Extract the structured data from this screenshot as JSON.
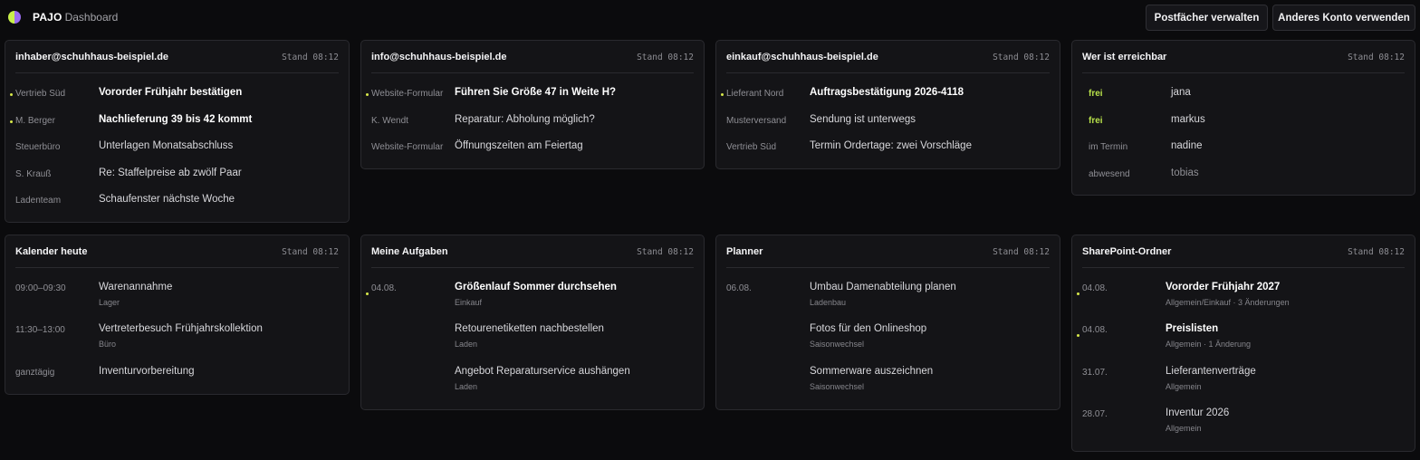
{
  "header": {
    "brand": "PAJO",
    "title": "Dashboard",
    "buttons": [
      "Postfächer verwalten",
      "Anderes Konto verwenden"
    ]
  },
  "colors": {
    "accent": "#d7e84a",
    "free": "#b7e04a",
    "logo_left": "#c9f04a",
    "logo_right": "#9a6df0"
  },
  "mailboxes": [
    {
      "title": "inhaber@schuhhaus-beispiel.de",
      "stamp": "Stand 08:12",
      "items": [
        {
          "sender": "Vertrieb Süd",
          "subject": "Vororder Frühjahr bestätigen",
          "unread": true
        },
        {
          "sender": "M. Berger",
          "subject": "Nachlieferung 39 bis 42 kommt",
          "unread": true
        },
        {
          "sender": "Steuerbüro",
          "subject": "Unterlagen Monatsabschluss",
          "unread": false
        },
        {
          "sender": "S. Krauß",
          "subject": "Re: Staffelpreise ab zwölf Paar",
          "unread": false
        },
        {
          "sender": "Ladenteam",
          "subject": "Schaufenster nächste Woche",
          "unread": false
        }
      ]
    },
    {
      "title": "info@schuhhaus-beispiel.de",
      "stamp": "Stand 08:12",
      "items": [
        {
          "sender": "Website-Formular",
          "subject": "Führen Sie Größe 47 in Weite H?",
          "unread": true
        },
        {
          "sender": "K. Wendt",
          "subject": "Reparatur: Abholung möglich?",
          "unread": false
        },
        {
          "sender": "Website-Formular",
          "subject": "Öffnungszeiten am Feiertag",
          "unread": false
        }
      ]
    },
    {
      "title": "einkauf@schuhhaus-beispiel.de",
      "stamp": "Stand 08:12",
      "items": [
        {
          "sender": "Lieferant Nord",
          "subject": "Auftragsbestätigung 2026-4118",
          "unread": true
        },
        {
          "sender": "Musterversand",
          "subject": "Sendung ist unterwegs",
          "unread": false
        },
        {
          "sender": "Vertrieb Süd",
          "subject": "Termin Ordertage: zwei Vorschläge",
          "unread": false
        }
      ]
    }
  ],
  "availability": {
    "title": "Wer ist erreichbar",
    "stamp": "Stand 08:12",
    "people": [
      {
        "status": "frei",
        "name": "jana"
      },
      {
        "status": "frei",
        "name": "markus"
      },
      {
        "status": "im Termin",
        "name": "nadine"
      },
      {
        "status": "abwesend",
        "name": "tobias"
      }
    ]
  },
  "calendar": {
    "title": "Kalender heute",
    "stamp": "Stand 08:12",
    "events": [
      {
        "time": "09:00–09:30",
        "title": "Warenannahme",
        "location": "Lager"
      },
      {
        "time": "11:30–13:00",
        "title": "Vertreterbesuch Frühjahrskollektion",
        "location": "Büro"
      },
      {
        "time": "ganztägig",
        "title": "Inventurvorbereitung",
        "location": ""
      }
    ]
  },
  "tasks": {
    "title": "Meine Aufgaben",
    "stamp": "Stand 08:12",
    "items": [
      {
        "date": "04.08.",
        "title": "Größenlauf Sommer durchsehen",
        "category": "Einkauf",
        "highlight": true
      },
      {
        "date": "",
        "title": "Retourenetiketten nachbestellen",
        "category": "Laden",
        "highlight": false
      },
      {
        "date": "",
        "title": "Angebot Reparaturservice aushängen",
        "category": "Laden",
        "highlight": false
      }
    ]
  },
  "planner": {
    "title": "Planner",
    "stamp": "Stand 08:12",
    "items": [
      {
        "date": "06.08.",
        "title": "Umbau Damenabteilung planen",
        "category": "Ladenbau"
      },
      {
        "date": "",
        "title": "Fotos für den Onlineshop",
        "category": "Saisonwechsel"
      },
      {
        "date": "",
        "title": "Sommerware auszeichnen",
        "category": "Saisonwechsel"
      }
    ]
  },
  "sharepoint": {
    "title": "SharePoint-Ordner",
    "stamp": "Stand 08:12",
    "items": [
      {
        "date": "04.08.",
        "title": "Vororder Frühjahr 2027",
        "detail": "Allgemein/Einkauf · 3 Änderungen",
        "highlight": true
      },
      {
        "date": "04.08.",
        "title": "Preislisten",
        "detail": "Allgemein · 1 Änderung",
        "highlight": true
      },
      {
        "date": "31.07.",
        "title": "Lieferantenverträge",
        "detail": "Allgemein",
        "highlight": false
      },
      {
        "date": "28.07.",
        "title": "Inventur 2026",
        "detail": "Allgemein",
        "highlight": false
      }
    ]
  }
}
